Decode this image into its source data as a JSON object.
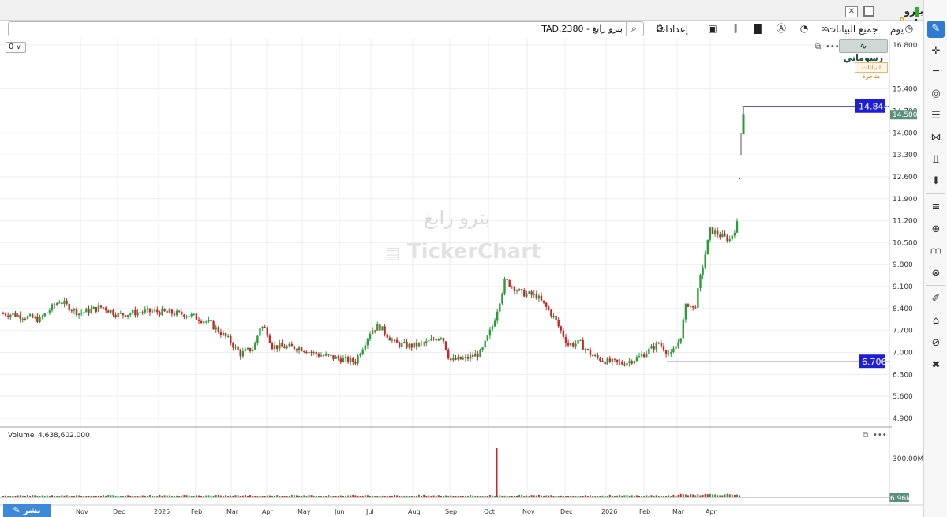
{
  "window": {
    "title": "بترو رابغ",
    "badge": "D",
    "close_glyph": "✕"
  },
  "toolbar": {
    "symbol": "TAD.2380 - بترو رابغ",
    "period_label": "يوم",
    "all_data_label": "جميع البيانات",
    "settings_label": "إعدادات"
  },
  "chart": {
    "zoom_value": "0",
    "drawings_label": "رسوماتي",
    "delayed_label": "البيانات متأخرة",
    "watermark_name": "بترو رابغ",
    "watermark_brand": "TickerChart",
    "last_price_label": "14.580",
    "line_high_label": "14.844",
    "line_low_label": "6.706",
    "publish_label": "نشر",
    "colors": {
      "up": "#2a9d3a",
      "down": "#c62828",
      "line": "#1e1ed2",
      "last_price": "#5a8f7b",
      "grid": "#eeeeee"
    }
  },
  "volume_panel": {
    "title": "Volume",
    "value": "4,638,602.000",
    "tick_top": "300.00M",
    "last_label": "6.96M"
  },
  "chart_data": {
    "type": "candlestick",
    "y_ticks": [
      "16.800",
      "15.400",
      "14.700",
      "14.000",
      "13.300",
      "12.600",
      "11.900",
      "11.200",
      "10.500",
      "9.800",
      "9.100",
      "8.400",
      "7.700",
      "7.000",
      "6.300",
      "5.600",
      "4.900"
    ],
    "x_ticks": [
      "Nov",
      "Dec",
      "2025",
      "Feb",
      "Mar",
      "Apr",
      "May",
      "Jun",
      "Jul",
      "Aug",
      "Sep",
      "Oct",
      "Nov",
      "Dec",
      "2026",
      "Feb",
      "Mar",
      "Apr"
    ],
    "ylim": [
      4.6,
      16.9
    ],
    "price_path": [
      [
        0,
        8.25
      ],
      [
        20,
        8.2
      ],
      [
        50,
        8.05
      ],
      [
        75,
        8.65
      ],
      [
        100,
        8.25
      ],
      [
        130,
        8.45
      ],
      [
        150,
        8.2
      ],
      [
        180,
        8.3
      ],
      [
        200,
        8.3
      ],
      [
        240,
        8.2
      ],
      [
        265,
        7.95
      ],
      [
        290,
        7.4
      ],
      [
        305,
        6.95
      ],
      [
        322,
        7.15
      ],
      [
        330,
        7.85
      ],
      [
        338,
        7.7
      ],
      [
        345,
        7.2
      ],
      [
        380,
        7.15
      ],
      [
        400,
        6.95
      ],
      [
        430,
        6.8
      ],
      [
        450,
        6.7
      ],
      [
        470,
        7.7
      ],
      [
        480,
        7.85
      ],
      [
        500,
        7.3
      ],
      [
        520,
        7.2
      ],
      [
        540,
        7.3
      ],
      [
        560,
        7.55
      ],
      [
        570,
        6.75
      ],
      [
        590,
        6.8
      ],
      [
        610,
        7.0
      ],
      [
        625,
        7.9
      ],
      [
        640,
        9.3
      ],
      [
        660,
        8.9
      ],
      [
        680,
        8.8
      ],
      [
        700,
        8.2
      ],
      [
        720,
        7.25
      ],
      [
        735,
        7.3
      ],
      [
        750,
        6.9
      ],
      [
        770,
        6.7
      ],
      [
        790,
        6.65
      ],
      [
        810,
        6.85
      ],
      [
        835,
        7.3
      ],
      [
        850,
        6.9
      ],
      [
        862,
        7.45
      ],
      [
        870,
        8.6
      ],
      [
        880,
        8.35
      ],
      [
        890,
        9.7
      ],
      [
        900,
        10.9
      ],
      [
        915,
        10.7
      ],
      [
        925,
        10.6
      ],
      [
        935,
        11.15
      ]
    ],
    "gap_points": [
      [
        937,
        12.55
      ],
      [
        939,
        13.8
      ],
      [
        942,
        14.45
      ]
    ],
    "line_high": 14.844,
    "line_low": 6.706,
    "last_price": 14.58,
    "volume_spike": {
      "month": "Oct",
      "value": 300
    }
  }
}
